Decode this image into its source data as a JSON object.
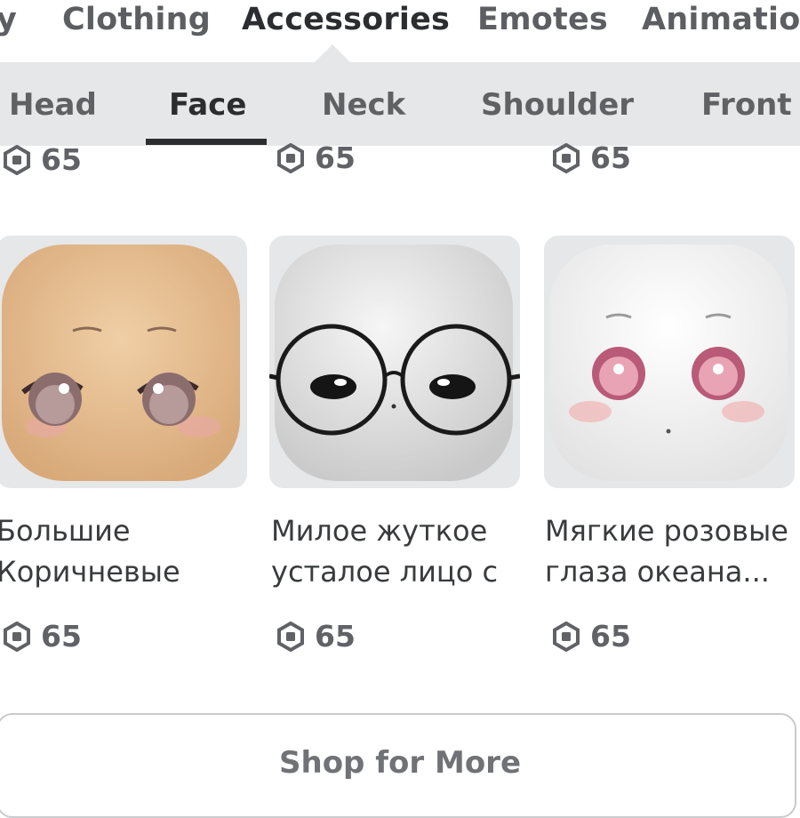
{
  "categories": [
    "y",
    "Clothing",
    "Accessories",
    "Emotes",
    "Animation"
  ],
  "active_category": "Accessories",
  "subcategories": [
    "Head",
    "Face",
    "Neck",
    "Shoulder",
    "Front"
  ],
  "active_subcategory": "Face",
  "top_prices": [
    "65",
    "65",
    "65"
  ],
  "items": [
    {
      "name_line1": "Большие",
      "name_line2": "Коричневые",
      "price": "65",
      "skin": "#e8c39a"
    },
    {
      "name_line1": "Милое жуткое",
      "name_line2": "усталое лицо с",
      "price": "65",
      "skin": "#ededed"
    },
    {
      "name_line1": "Мягкие розовые",
      "name_line2": "глаза океана...",
      "price": "65",
      "skin": "#f7f7f7"
    }
  ],
  "currency_icon": "robux-icon",
  "shop_button_label": "Shop for More"
}
